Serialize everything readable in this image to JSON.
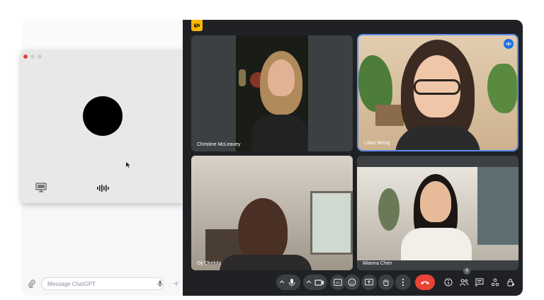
{
  "chat": {
    "composer_placeholder": "Message ChatGPT"
  },
  "meet": {
    "participants": [
      {
        "name": "Christine McLeavey"
      },
      {
        "name": "Lilian Weng"
      },
      {
        "name": "Oji Okelola"
      },
      {
        "name": "Mianna Chen"
      }
    ],
    "people_count": "4"
  },
  "icons": [
    "attach-icon",
    "mic-icon",
    "send-icon",
    "screen-share-icon",
    "voice-wave-icon",
    "chevron-up-icon",
    "camera-icon",
    "captions-icon",
    "emoji-icon",
    "present-icon",
    "raise-hand-icon",
    "more-icon",
    "end-call-icon",
    "info-icon",
    "people-icon",
    "chat-icon",
    "activities-icon",
    "host-controls-icon"
  ],
  "colors": {
    "meet_background": "#202124",
    "tile_background": "#3c4043",
    "end_call": "#ea4335",
    "speaking_outline": "#5b8def",
    "meet_badge": "#f7b500"
  }
}
